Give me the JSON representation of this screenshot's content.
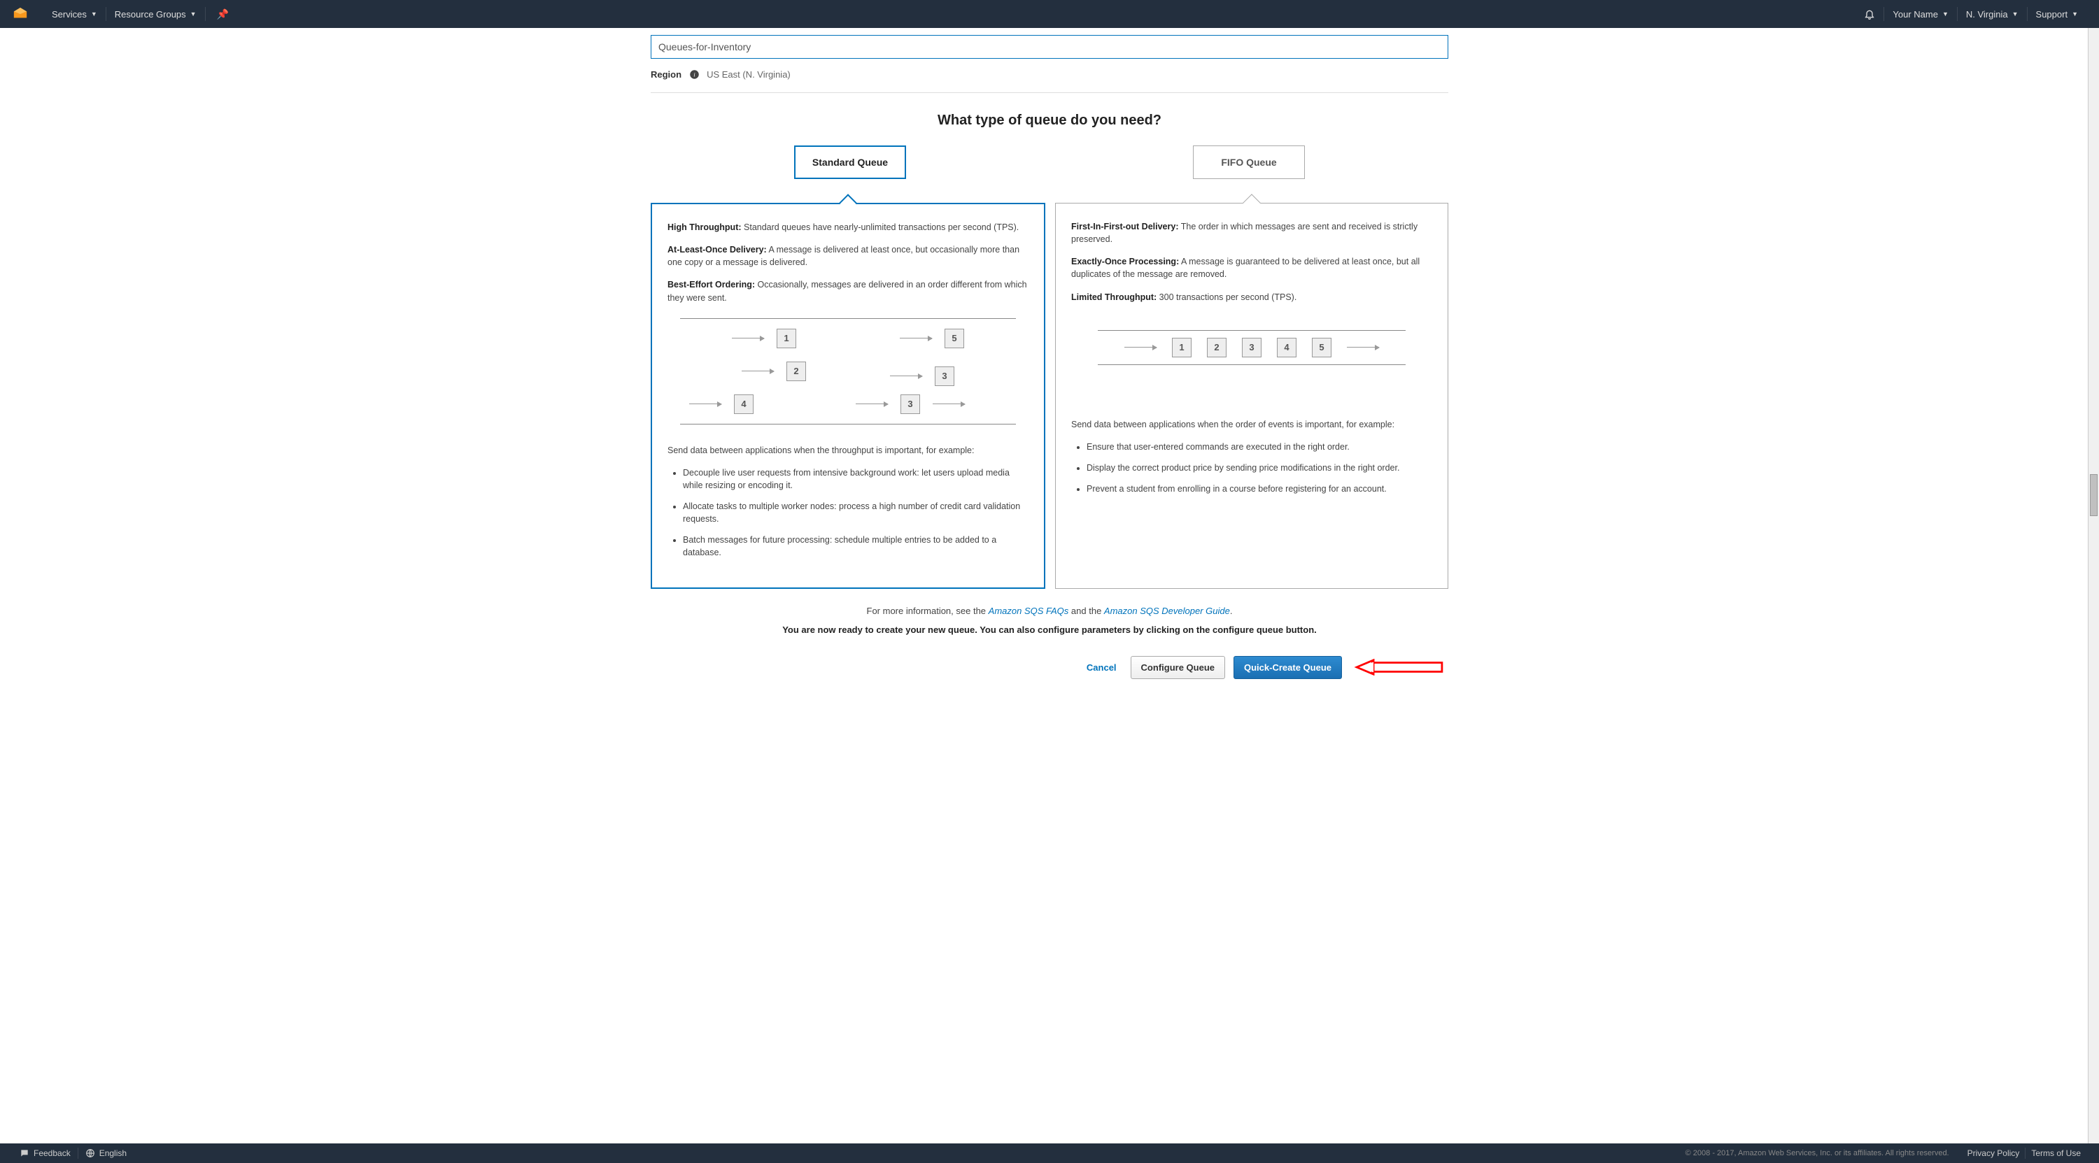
{
  "nav": {
    "services": "Services",
    "resource_groups": "Resource Groups",
    "account": "Your Name",
    "region_sel": "N. Virginia",
    "support": "Support"
  },
  "form": {
    "queue_name_value": "Queues-for-Inventory",
    "region_label": "Region",
    "region_value": "US East (N. Virginia)"
  },
  "headline": "What type of queue do you need?",
  "types": {
    "standard_label": "Standard Queue",
    "fifo_label": "FIFO Queue"
  },
  "standard": {
    "p1_b": "High Throughput:",
    "p1": " Standard queues have nearly-unlimited transactions per second (TPS).",
    "p2_b": "At-Least-Once Delivery:",
    "p2": " A message is delivered at least once, but occasionally more than one copy or a message is delivered.",
    "p3_b": "Best-Effort Ordering:",
    "p3": " Occasionally, messages are delivered in an order different from which they were sent.",
    "usecase": "Send data between applications when the throughput is important, for example:",
    "li1": "Decouple live user requests from intensive background work: let users upload media while resizing or encoding it.",
    "li2": "Allocate tasks to multiple worker nodes: process a high number of credit card validation requests.",
    "li3": "Batch messages for future processing: schedule multiple entries to be added to a database.",
    "n1": "1",
    "n2": "2",
    "n3": "3",
    "n4": "4",
    "n5": "5"
  },
  "fifo": {
    "p1_b": "First-In-First-out Delivery:",
    "p1": " The order in which messages are sent and received is strictly preserved.",
    "p2_b": "Exactly-Once Processing:",
    "p2": " A message is guaranteed to be delivered at least once, but all duplicates of the message are removed.",
    "p3_b": "Limited Throughput:",
    "p3": " 300 transactions per second (TPS).",
    "usecase": "Send data between applications when the order of events is important, for example:",
    "li1": "Ensure that user-entered commands are executed in the right order.",
    "li2": "Display the correct product price by sending price modifications in the right order.",
    "li3": "Prevent a student from enrolling in a course before registering for an account.",
    "n1": "1",
    "n2": "2",
    "n3": "3",
    "n4": "4",
    "n5": "5"
  },
  "moreinfo": {
    "prefix": "For more information, see the ",
    "link1": "Amazon SQS FAQs",
    "mid": " and the ",
    "link2": "Amazon SQS Developer Guide",
    "suffix": "."
  },
  "ready": "You are now ready to create your new queue. You can also configure parameters by clicking on the configure queue button.",
  "actions": {
    "cancel": "Cancel",
    "configure": "Configure Queue",
    "quick_create": "Quick-Create Queue"
  },
  "footer": {
    "feedback": "Feedback",
    "language": "English",
    "copyright": "© 2008 - 2017, Amazon Web Services, Inc. or its affiliates. All rights reserved.",
    "privacy": "Privacy Policy",
    "terms": "Terms of Use"
  }
}
